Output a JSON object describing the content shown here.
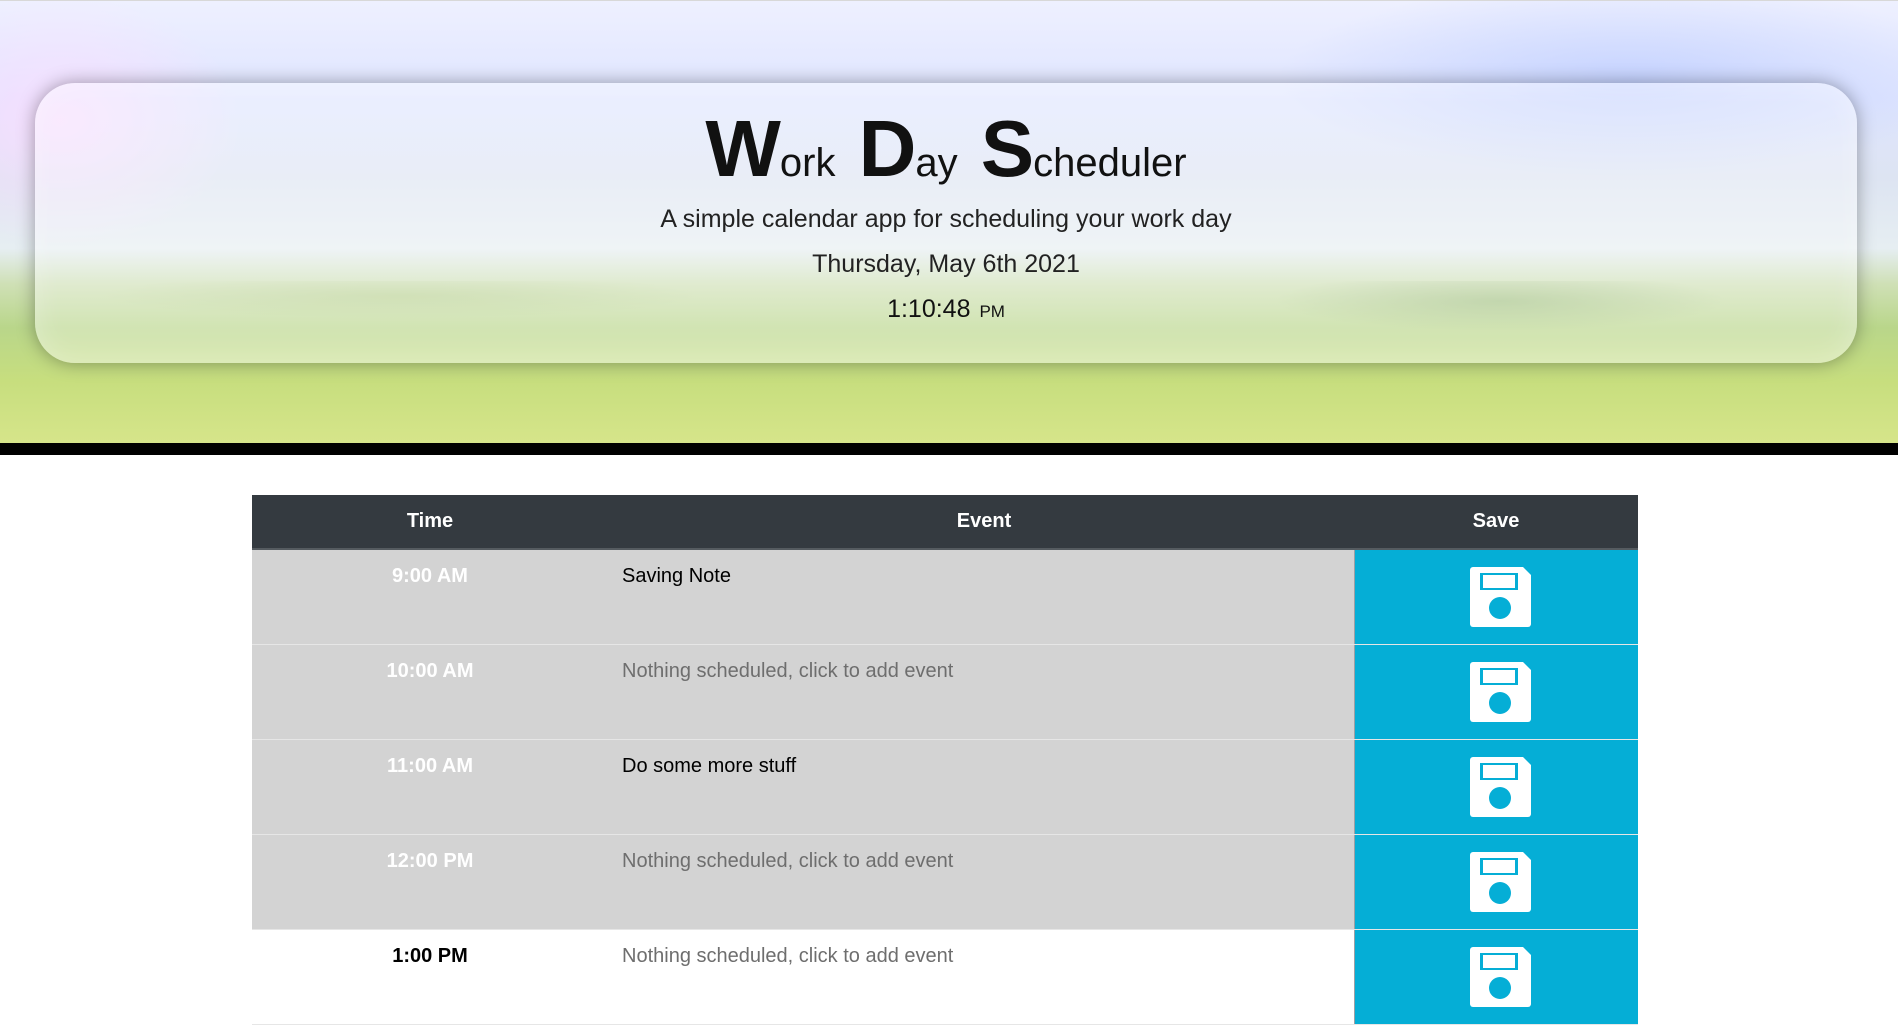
{
  "header": {
    "title_words": [
      {
        "cap": "W",
        "rest": "ork"
      },
      {
        "cap": "D",
        "rest": "ay"
      },
      {
        "cap": "S",
        "rest": "cheduler"
      }
    ],
    "subtitle": "A simple calendar app for scheduling your work day",
    "date": "Thursday, May 6th 2021",
    "time": "1:10:48",
    "ampm": "PM"
  },
  "table": {
    "headers": {
      "time": "Time",
      "event": "Event",
      "save": "Save"
    },
    "rows": [
      {
        "time": "9:00 AM",
        "event": "Saving Note",
        "empty": false,
        "status": "past"
      },
      {
        "time": "10:00 AM",
        "event": "Nothing scheduled, click to add event",
        "empty": true,
        "status": "past"
      },
      {
        "time": "11:00 AM",
        "event": "Do some more stuff",
        "empty": false,
        "status": "past"
      },
      {
        "time": "12:00 PM",
        "event": "Nothing scheduled, click to add event",
        "empty": true,
        "status": "past"
      },
      {
        "time": "1:00 PM",
        "event": "Nothing scheduled, click to add event",
        "empty": true,
        "status": "present"
      }
    ],
    "save_icon": "floppy-disk-icon"
  },
  "colors": {
    "header_bg": "#343a40",
    "past_row": "#d3d3d3",
    "save_bg": "#05aed6",
    "divider": "#000000"
  }
}
